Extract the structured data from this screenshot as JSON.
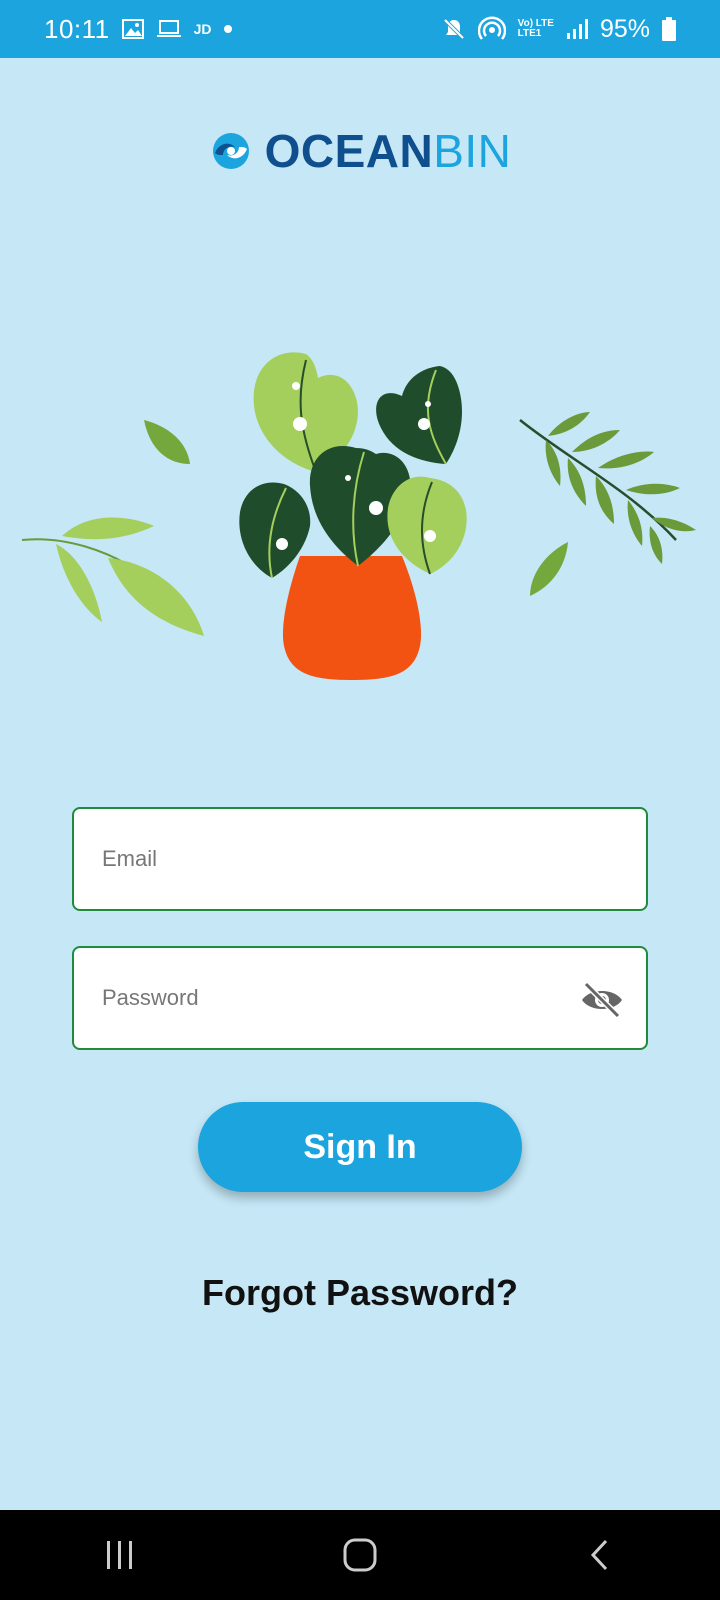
{
  "status_bar": {
    "time": "10:11",
    "carrier_tag": "JD",
    "lte_top": "Vo) LTE",
    "lte_bottom": "LTE1",
    "battery_percent": "95%",
    "icons": [
      "image-icon",
      "laptop-icon",
      "mute-icon",
      "hotspot-icon",
      "signal-icon",
      "battery-icon"
    ]
  },
  "logo": {
    "text_primary": "OCEAN",
    "text_secondary": "BIN",
    "brand_dark": "#0f4f8e",
    "brand_light": "#1ba4de"
  },
  "form": {
    "email_placeholder": "Email",
    "password_placeholder": "Password",
    "sign_in_label": "Sign In",
    "forgot_label": "Forgot Password?"
  },
  "colors": {
    "background": "#c5e7f6",
    "accent": "#1ba4de",
    "input_border": "#1f8b3c",
    "pot": "#f25312"
  },
  "nav": {
    "icons": [
      "recents-icon",
      "home-icon",
      "back-icon"
    ]
  }
}
